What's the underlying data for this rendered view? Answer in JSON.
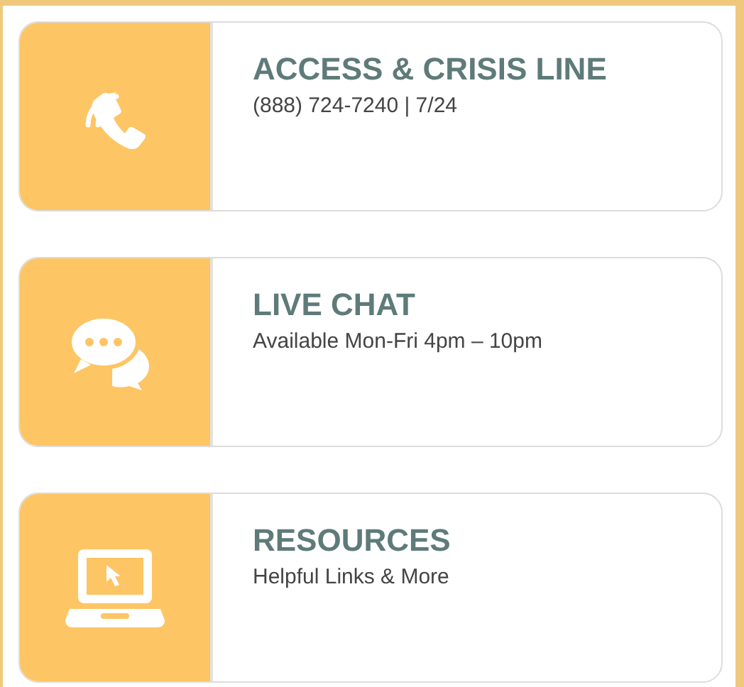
{
  "cards": [
    {
      "kind": "phone",
      "title": "ACCESS & CRISIS LINE",
      "subtitle": "(888) 724-7240 | 7/24"
    },
    {
      "kind": "chat",
      "title": "LIVE CHAT",
      "subtitle": "Available Mon-Fri 4pm – 10pm"
    },
    {
      "kind": "laptop",
      "title": "RESOURCES",
      "subtitle": "Helpful Links & More"
    }
  ]
}
